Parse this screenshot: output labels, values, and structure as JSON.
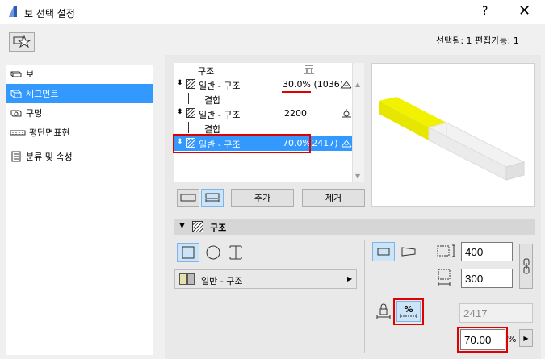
{
  "window": {
    "title": "보 선택 설정",
    "help_label": "?",
    "close_label": "✕"
  },
  "selection_info": "선택됨: 1 편집가능: 1",
  "nav": {
    "items": [
      {
        "label": "보",
        "icon": "beam-icon"
      },
      {
        "label": "세그먼트",
        "icon": "segment-icon",
        "selected": true
      },
      {
        "label": "구멍",
        "icon": "hole-icon"
      },
      {
        "label": "평단면표현",
        "icon": "floor-plan-icon"
      },
      {
        "label": "분류 및 속성",
        "icon": "classification-icon"
      }
    ]
  },
  "segments": {
    "header": "구조",
    "rows": [
      {
        "label": "일반 - 구조",
        "value": "30.0% (1036)"
      },
      {
        "label": "결합"
      },
      {
        "label": "일반 - 구조",
        "value": "2200"
      },
      {
        "label": "결합"
      },
      {
        "label": "일반 - 구조",
        "value": "70.0%",
        "extra": "(2417)"
      }
    ]
  },
  "buttons": {
    "add": "추가",
    "remove": "제거"
  },
  "section": {
    "title": "구조"
  },
  "profile_dropdown": {
    "value": "일반 - 구조"
  },
  "dimensions": {
    "width": "400",
    "height": "300",
    "length_disabled": "2417",
    "percent": "70.00",
    "percent_unit": "%",
    "percent_button_label": "%"
  },
  "colors": {
    "selection": "#3399ff",
    "highlight": "#e00000",
    "preview_yellow": "#e6e600"
  }
}
